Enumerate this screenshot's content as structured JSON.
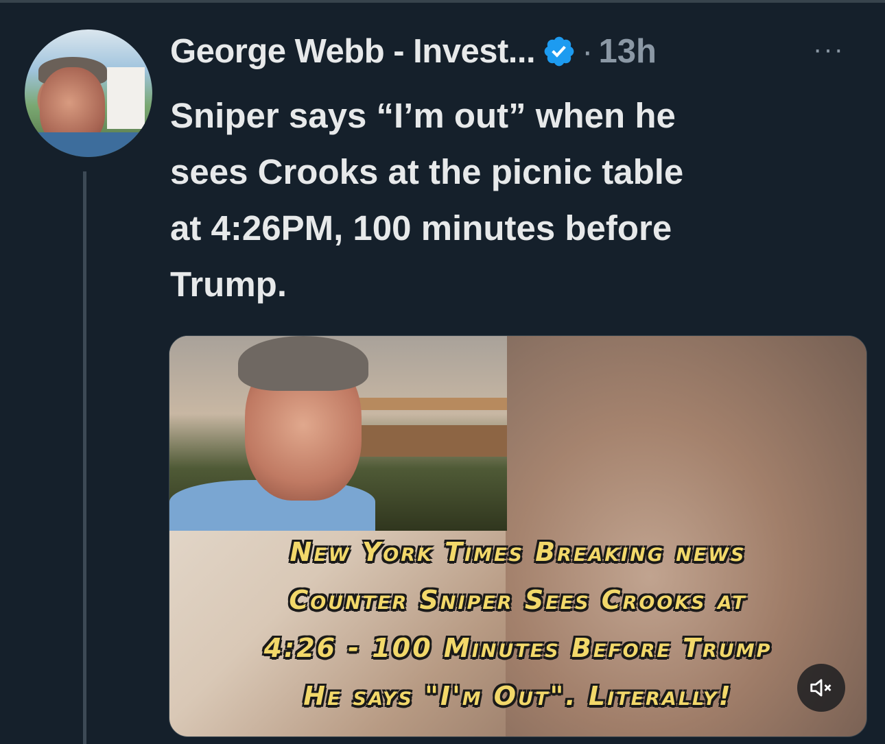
{
  "author": {
    "name": "George Webb - Invest...",
    "dot": "·",
    "time": "13h"
  },
  "more_label": "···",
  "tweet": {
    "lines": [
      "Sniper says “I’m out” when he",
      "sees Crooks at the picnic table",
      "at 4:26PM, 100 minutes before",
      "Trump."
    ]
  },
  "media": {
    "caption": [
      "New York Times Breaking news",
      "Counter Sniper Sees Crooks at",
      "4:26 - 100 Minutes Before Trump",
      "He says \"I'm Out\". Literally!"
    ]
  },
  "icons": {
    "verified": "verified-badge-icon",
    "more": "more-icon",
    "mute": "speaker-muted-icon"
  },
  "colors": {
    "background": "#15202b",
    "verified": "#1d9bf0",
    "caption": "#f2d86a"
  }
}
